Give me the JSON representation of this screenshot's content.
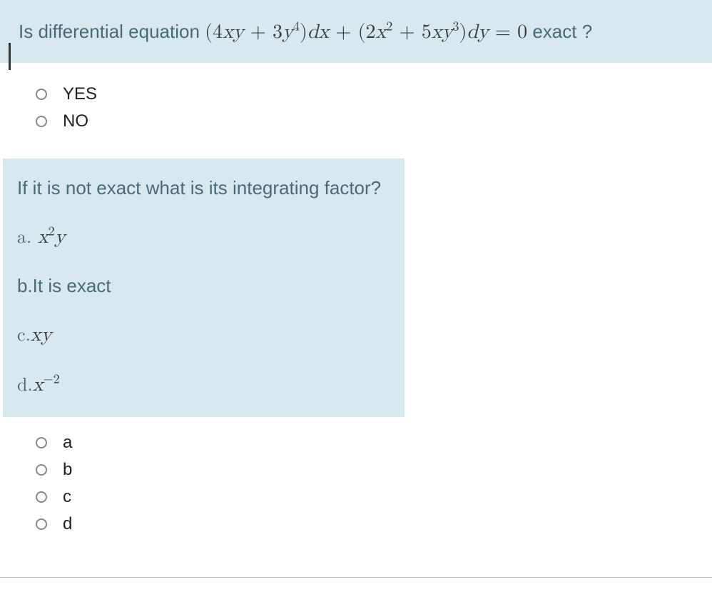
{
  "q1": {
    "prefix": "Is differential equation ",
    "equation_html": "(4<i>xy</i> + 3<i>y</i><sup>4</sup>)<i>dx</i> + (2<i>x</i><sup>2</sup> + 5<i>xy</i><sup>3</sup>)<i>dy</i> = 0",
    "suffix": " exact ?",
    "options": [
      "YES",
      "NO"
    ]
  },
  "q2": {
    "prompt": "If it is not exact what is its integrating factor?",
    "choices": {
      "a_prefix": "a. ",
      "a_math": "<i>x</i><sup>2</sup><i>y</i>",
      "b": "b.It is exact",
      "c_prefix": "c.",
      "c_math": "<i>xy</i>",
      "d_prefix": "d.",
      "d_math": "<i>x</i><sup>&minus;2</sup>"
    },
    "options": [
      "a",
      "b",
      "c",
      "d"
    ]
  }
}
